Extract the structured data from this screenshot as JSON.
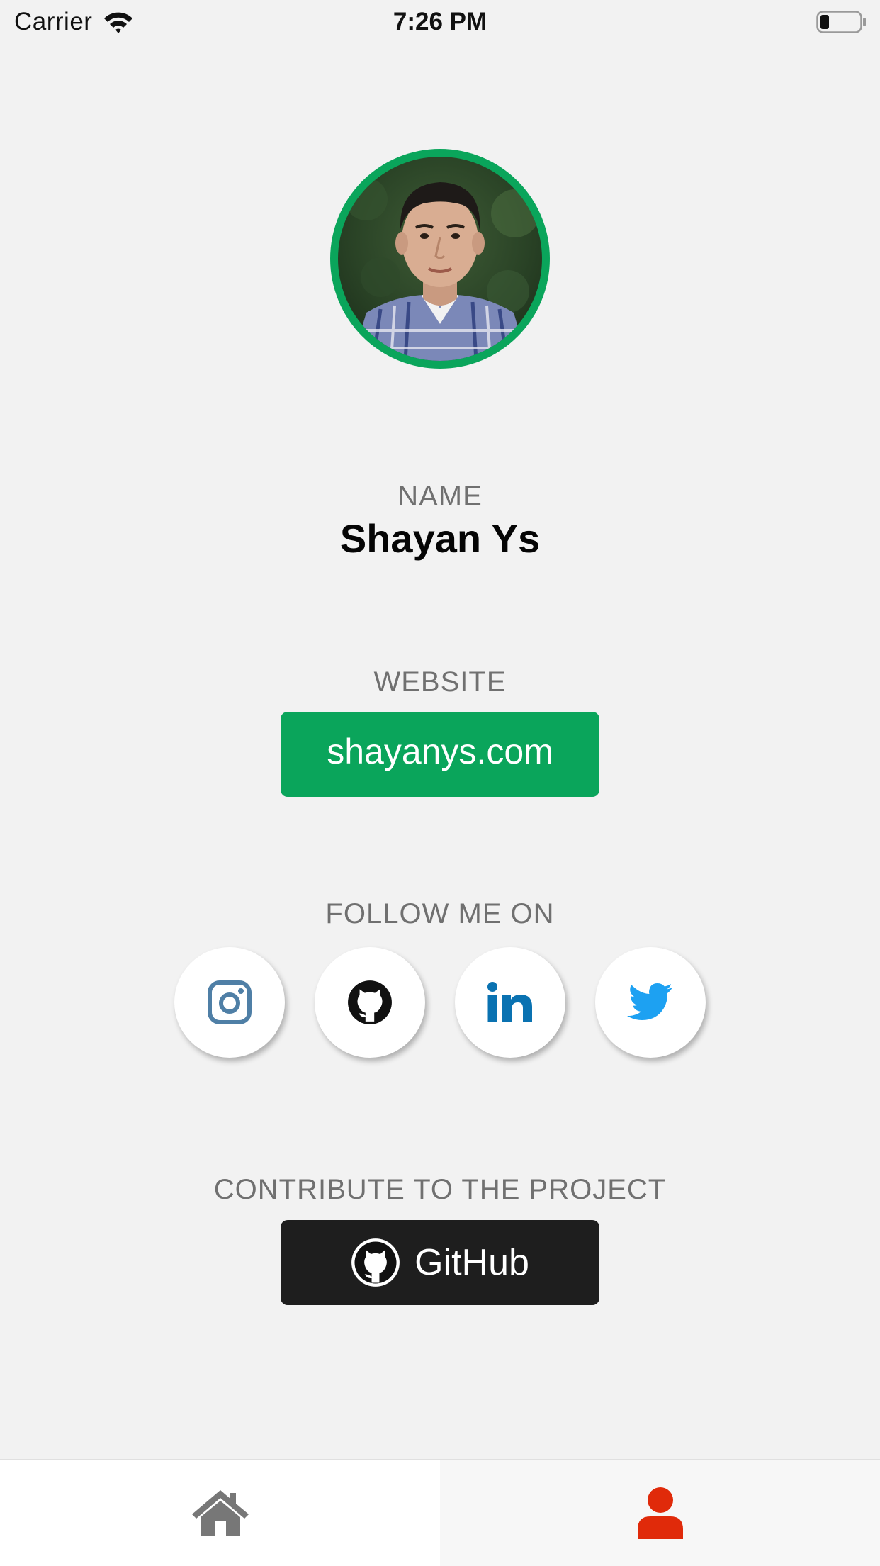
{
  "status_bar": {
    "carrier": "Carrier",
    "time": "7:26 PM"
  },
  "profile": {
    "avatar_ring_color": "#0aa55b",
    "name_label": "NAME",
    "name": "Shayan Ys",
    "website_label": "WEBSITE",
    "website": "shayanys.com",
    "website_button_color": "#0aa55b",
    "follow_label": "FOLLOW ME ON",
    "social_links": [
      {
        "icon": "instagram-icon",
        "color": "#4f7fa6"
      },
      {
        "icon": "github-icon",
        "color": "#111111"
      },
      {
        "icon": "linkedin-icon",
        "color": "#0a72b1"
      },
      {
        "icon": "twitter-icon",
        "color": "#1da1f2"
      }
    ],
    "contribute_label": "CONTRIBUTE TO THE PROJECT",
    "contribute_button": "GitHub",
    "contribute_button_color": "#1e1e1e"
  },
  "tab_bar": {
    "tabs": [
      {
        "icon": "home-icon",
        "active": false,
        "color": "#777777"
      },
      {
        "icon": "user-icon",
        "active": true,
        "color": "#e02a0a"
      }
    ]
  }
}
